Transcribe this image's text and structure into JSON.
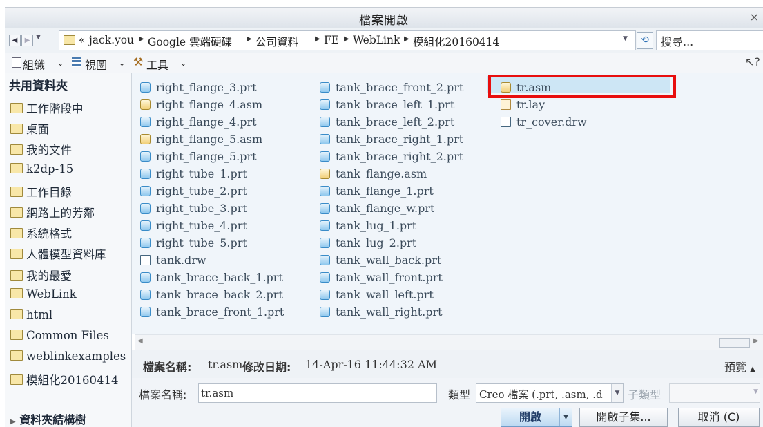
{
  "window": {
    "title": "檔案開啟",
    "close": "×"
  },
  "address": {
    "prefix": "«",
    "crumbs": [
      "jack.you",
      "Google 雲端硬碟",
      "公司資料",
      "FE",
      "WebLink",
      "模組化20160414"
    ],
    "search_placeholder": "搜尋..."
  },
  "toolbar": {
    "organize": "組織",
    "view": "視圖",
    "tools": "工具"
  },
  "sidebar": {
    "header": "共用資料夾",
    "items": [
      "工作階段中",
      "桌面",
      "我的文件",
      "k2dp-15",
      "工作目錄",
      "網路上的芳鄰",
      "系統格式",
      "人體模型資料庫",
      "我的最愛",
      "WebLink",
      "html",
      "Common Files",
      "weblinkexamples",
      "模組化20160414"
    ],
    "folder_tree": "資料夾結構樹"
  },
  "files": {
    "col1": [
      {
        "name": "right_flange_3.prt",
        "type": "prt"
      },
      {
        "name": "right_flange_4.asm",
        "type": "asm"
      },
      {
        "name": "right_flange_4.prt",
        "type": "prt"
      },
      {
        "name": "right_flange_5.asm",
        "type": "asm"
      },
      {
        "name": "right_flange_5.prt",
        "type": "prt"
      },
      {
        "name": "right_tube_1.prt",
        "type": "prt"
      },
      {
        "name": "right_tube_2.prt",
        "type": "prt"
      },
      {
        "name": "right_tube_3.prt",
        "type": "prt"
      },
      {
        "name": "right_tube_4.prt",
        "type": "prt"
      },
      {
        "name": "right_tube_5.prt",
        "type": "prt"
      },
      {
        "name": "tank.drw",
        "type": "drw"
      },
      {
        "name": "tank_brace_back_1.prt",
        "type": "prt"
      },
      {
        "name": "tank_brace_back_2.prt",
        "type": "prt"
      },
      {
        "name": "tank_brace_front_1.prt",
        "type": "prt"
      }
    ],
    "col2": [
      {
        "name": "tank_brace_front_2.prt",
        "type": "prt"
      },
      {
        "name": "tank_brace_left_1.prt",
        "type": "prt"
      },
      {
        "name": "tank_brace_left_2.prt",
        "type": "prt"
      },
      {
        "name": "tank_brace_right_1.prt",
        "type": "prt"
      },
      {
        "name": "tank_brace_right_2.prt",
        "type": "prt"
      },
      {
        "name": "tank_flange.asm",
        "type": "asm"
      },
      {
        "name": "tank_flange_1.prt",
        "type": "prt"
      },
      {
        "name": "tank_flange_w.prt",
        "type": "prt"
      },
      {
        "name": "tank_lug_1.prt",
        "type": "prt"
      },
      {
        "name": "tank_lug_2.prt",
        "type": "prt"
      },
      {
        "name": "tank_wall_back.prt",
        "type": "prt"
      },
      {
        "name": "tank_wall_front.prt",
        "type": "prt"
      },
      {
        "name": "tank_wall_left.prt",
        "type": "prt"
      },
      {
        "name": "tank_wall_right.prt",
        "type": "prt"
      }
    ],
    "col3": [
      {
        "name": "tr.asm",
        "type": "asm",
        "selected": true
      },
      {
        "name": "tr.lay",
        "type": "lay"
      },
      {
        "name": "tr_cover.drw",
        "type": "drw"
      }
    ]
  },
  "info": {
    "name_label": "檔案名稱:",
    "name_value": "tr.asm",
    "date_label": "修改日期:",
    "date_value": "14-Apr-16 11:44:32 AM",
    "preview": "預覽"
  },
  "form": {
    "filename_label": "檔案名稱:",
    "filename_value": "tr.asm",
    "type_label": "類型",
    "type_value": "Creo 檔案 (.prt, .asm, .d",
    "subtype_label": "子類型"
  },
  "buttons": {
    "open": "開啟",
    "open_subset": "開啟子集...",
    "cancel": "取消 (C)"
  },
  "colors": {
    "selection": "#cde6f5",
    "highlight_box": "#e80e0e"
  }
}
